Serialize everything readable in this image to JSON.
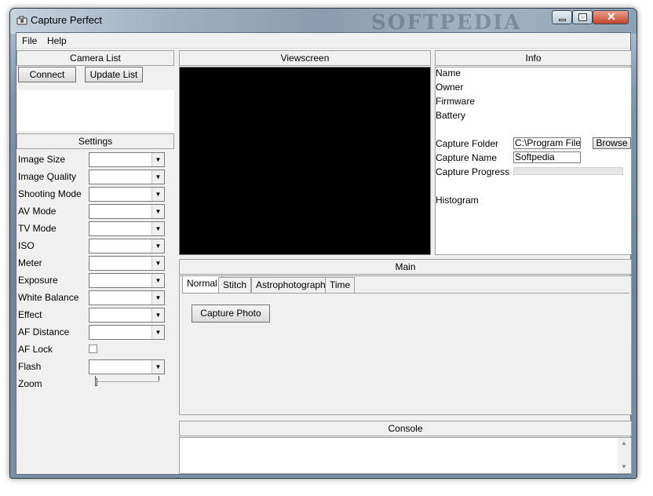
{
  "window": {
    "title": "Capture Perfect",
    "watermark": "SOFTPEDIA"
  },
  "menu": {
    "file": "File",
    "help": "Help"
  },
  "camera_list": {
    "header": "Camera List",
    "connect_label": "Connect",
    "update_label": "Update List"
  },
  "settings": {
    "header": "Settings",
    "rows": [
      {
        "label": "Image Size",
        "value": ""
      },
      {
        "label": "Image Quality",
        "value": ""
      },
      {
        "label": "Shooting Mode",
        "value": ""
      },
      {
        "label": "AV Mode",
        "value": ""
      },
      {
        "label": "TV Mode",
        "value": ""
      },
      {
        "label": "ISO",
        "value": ""
      },
      {
        "label": "Meter",
        "value": ""
      },
      {
        "label": "Exposure",
        "value": ""
      },
      {
        "label": "White Balance",
        "value": ""
      },
      {
        "label": "Effect",
        "value": ""
      },
      {
        "label": "AF Distance",
        "value": ""
      }
    ],
    "af_lock": {
      "label": "AF Lock",
      "checked": false
    },
    "flash": {
      "label": "Flash",
      "value": ""
    },
    "zoom": {
      "label": "Zoom",
      "level": 0
    }
  },
  "viewscreen": {
    "header": "Viewscreen"
  },
  "info": {
    "header": "Info",
    "name_label": "Name",
    "owner_label": "Owner",
    "firmware_label": "Firmware",
    "battery_label": "Battery",
    "capture_folder_label": "Capture Folder",
    "capture_folder_value": "C:\\Program Files",
    "browse_label": "Browse",
    "capture_name_label": "Capture Name",
    "capture_name_value": "Softpedia",
    "capture_progress_label": "Capture Progress",
    "capture_progress": 0,
    "histogram_label": "Histogram"
  },
  "main": {
    "header": "Main",
    "tabs": [
      "Normal",
      "Stitch",
      "Astrophotography",
      "Time"
    ],
    "active_tab": "Normal",
    "capture_photo_label": "Capture Photo"
  },
  "console": {
    "header": "Console",
    "text": ""
  },
  "colors": {
    "viewscreen_bg": "#000000",
    "panel_bg": "#f0f0f0"
  }
}
